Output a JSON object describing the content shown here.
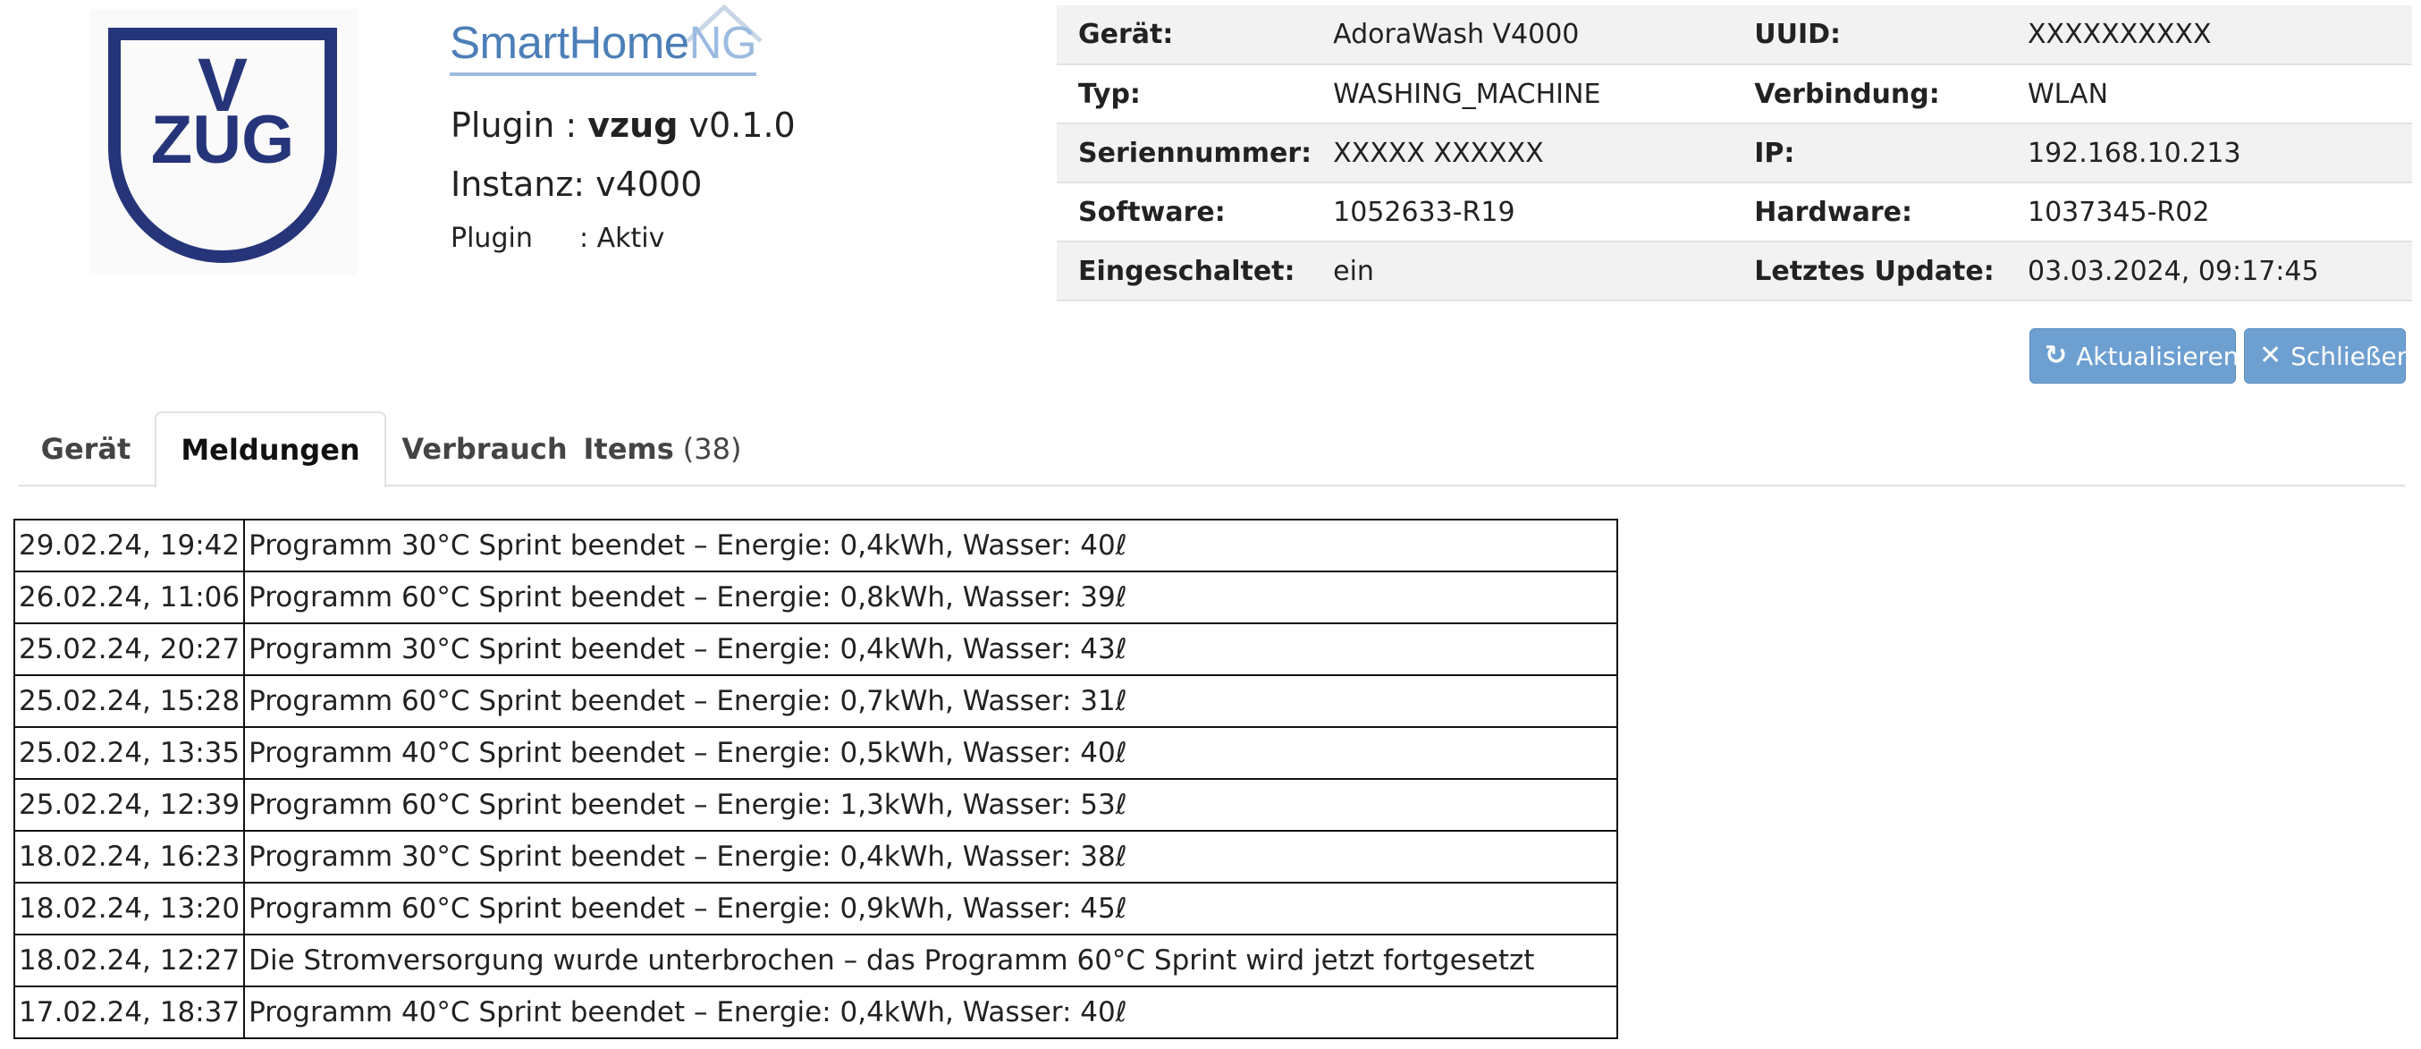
{
  "logo": {
    "brand": "V-ZUG",
    "line1": "V",
    "line2": "ZUG",
    "color": "#26357a"
  },
  "header": {
    "brand_main": "SmartHome",
    "brand_suffix": "NG",
    "plugin_prefix": "Plugin : ",
    "plugin_name": "vzug",
    "plugin_version": " v0.1.0",
    "instance": "Instanz: v4000",
    "status_label": "Plugin",
    "status_value": ": Aktiv"
  },
  "info": {
    "rows": [
      {
        "k1": "Gerät:",
        "v1": "AdoraWash V4000",
        "k2": "UUID:",
        "v2": "XXXXXXXXXX"
      },
      {
        "k1": "Typ:",
        "v1": "WASHING_MACHINE",
        "k2": "Verbindung:",
        "v2": "WLAN"
      },
      {
        "k1": "Seriennummer:",
        "v1": "XXXXX XXXXXX",
        "k2": "IP:",
        "v2": "192.168.10.213"
      },
      {
        "k1": "Software:",
        "v1": "1052633-R19",
        "k2": "Hardware:",
        "v2": "1037345-R02"
      },
      {
        "k1": "Eingeschaltet:",
        "v1": "ein",
        "k2": "Letztes Update:",
        "v2": "03.03.2024, 09:17:45"
      }
    ]
  },
  "buttons": {
    "refresh": {
      "label": "Aktualisieren",
      "icon": "refresh-icon"
    },
    "close": {
      "label": "Schließen",
      "icon": "close-icon"
    },
    "color": "#6e9fd1"
  },
  "tabs": [
    {
      "label": "Gerät",
      "count": ""
    },
    {
      "label": "Meldungen",
      "count": ""
    },
    {
      "label": "Verbrauch",
      "count": ""
    },
    {
      "label": "Items",
      "count": "(38)"
    }
  ],
  "active_tab": "Meldungen",
  "messages": [
    {
      "time": "29.02.24, 19:42",
      "text": "Programm 30°C Sprint beendet – Energie: 0,4kWh, Wasser: 40ℓ"
    },
    {
      "time": "26.02.24, 11:06",
      "text": "Programm 60°C Sprint beendet – Energie: 0,8kWh, Wasser: 39ℓ"
    },
    {
      "time": "25.02.24, 20:27",
      "text": "Programm 30°C Sprint beendet – Energie: 0,4kWh, Wasser: 43ℓ"
    },
    {
      "time": "25.02.24, 15:28",
      "text": "Programm 60°C Sprint beendet – Energie: 0,7kWh, Wasser: 31ℓ"
    },
    {
      "time": "25.02.24, 13:35",
      "text": "Programm 40°C Sprint beendet – Energie: 0,5kWh, Wasser: 40ℓ"
    },
    {
      "time": "25.02.24, 12:39",
      "text": "Programm 60°C Sprint beendet – Energie: 1,3kWh, Wasser: 53ℓ"
    },
    {
      "time": "18.02.24, 16:23",
      "text": "Programm 30°C Sprint beendet – Energie: 0,4kWh, Wasser: 38ℓ"
    },
    {
      "time": "18.02.24, 13:20",
      "text": "Programm 60°C Sprint beendet – Energie: 0,9kWh, Wasser: 45ℓ"
    },
    {
      "time": "18.02.24, 12:27",
      "text": "Die Stromversorgung wurde unterbrochen – das Programm 60°C Sprint wird jetzt fortgesetzt"
    },
    {
      "time": "17.02.24, 18:37",
      "text": "Programm 40°C Sprint beendet – Energie: 0,4kWh, Wasser: 40ℓ"
    }
  ]
}
